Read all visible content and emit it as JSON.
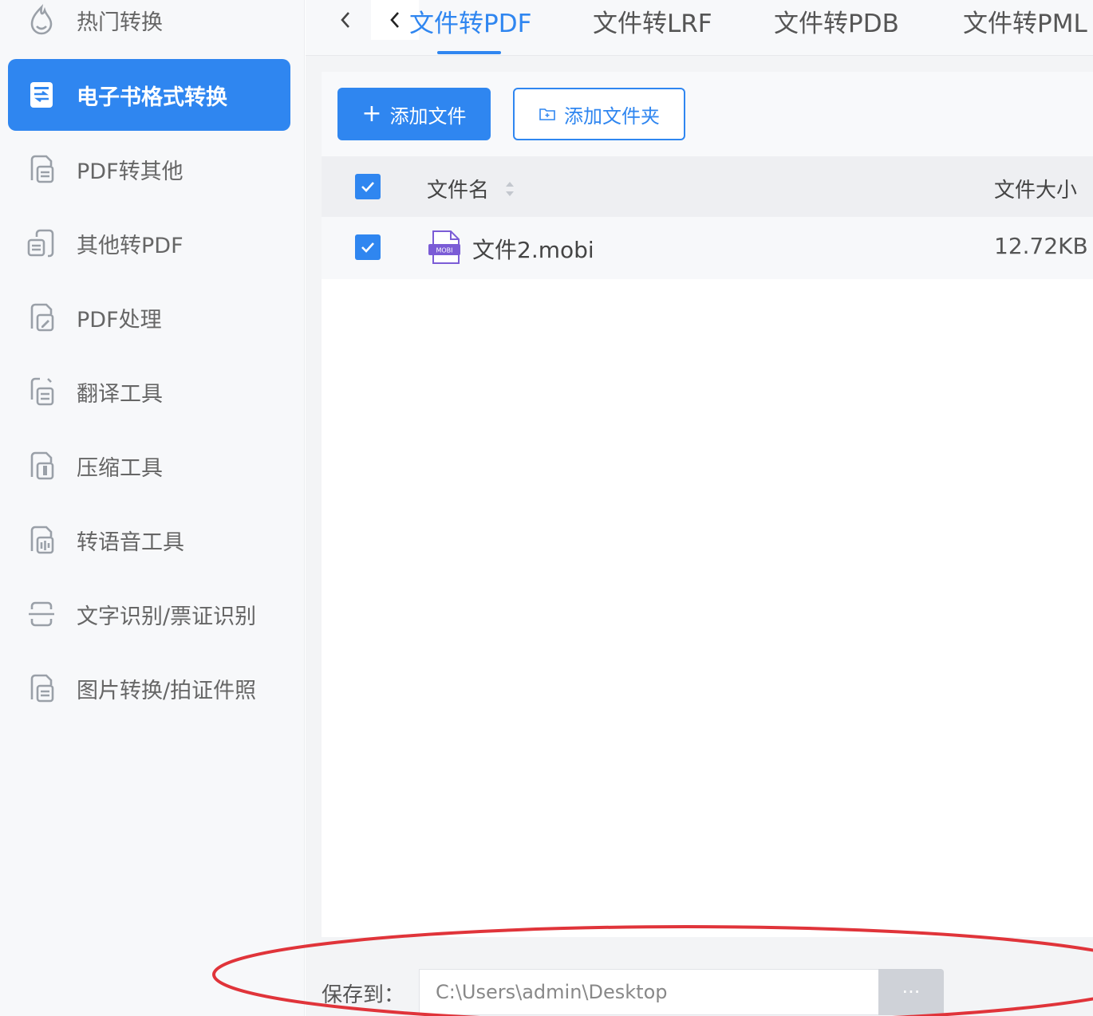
{
  "sidebar": {
    "items": [
      {
        "label": "热门转换",
        "icon": "flame-icon",
        "active": false
      },
      {
        "label": "电子书格式转换",
        "icon": "ebook-convert-icon",
        "active": true
      },
      {
        "label": "PDF转其他",
        "icon": "pdf-to-other-icon",
        "active": false
      },
      {
        "label": "其他转PDF",
        "icon": "other-to-pdf-icon",
        "active": false
      },
      {
        "label": "PDF处理",
        "icon": "pdf-edit-icon",
        "active": false
      },
      {
        "label": "翻译工具",
        "icon": "translate-icon",
        "active": false
      },
      {
        "label": "压缩工具",
        "icon": "compress-icon",
        "active": false
      },
      {
        "label": "转语音工具",
        "icon": "audio-icon",
        "active": false
      },
      {
        "label": "文字识别/票证识别",
        "icon": "ocr-scan-icon",
        "active": false
      },
      {
        "label": "图片转换/拍证件照",
        "icon": "image-convert-icon",
        "active": false
      }
    ]
  },
  "tabs": {
    "prev_icon": "chevron-left-icon",
    "items": [
      {
        "label": "文件转PDF",
        "active": true
      },
      {
        "label": "文件转LRF",
        "active": false
      },
      {
        "label": "文件转PDB",
        "active": false
      },
      {
        "label": "文件转PML",
        "active": false
      }
    ]
  },
  "toolbar": {
    "add_file_label": "添加文件",
    "add_folder_label": "添加文件夹"
  },
  "table": {
    "headers": {
      "name": "文件名",
      "size": "文件大小"
    },
    "select_all_checked": true,
    "rows": [
      {
        "checked": true,
        "type_badge": "MOBI",
        "name": "文件2.mobi",
        "size": "12.72KB"
      }
    ]
  },
  "footer": {
    "save_label": "保存到：",
    "save_path": "C:\\Users\\admin\\Desktop",
    "browse_label": "···"
  },
  "colors": {
    "accent": "#2f86f0",
    "annotation": "#e0343a",
    "sidebar_bg": "#f7f8fa"
  }
}
